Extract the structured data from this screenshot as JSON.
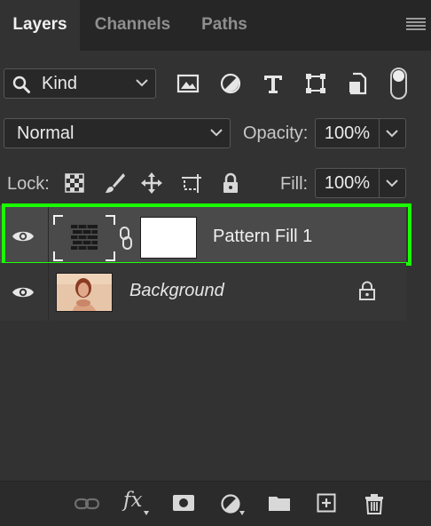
{
  "tabs": [
    {
      "label": "Layers",
      "active": true
    },
    {
      "label": "Channels",
      "active": false
    },
    {
      "label": "Paths",
      "active": false
    }
  ],
  "filter": {
    "kind_label": "Kind",
    "icons": [
      "image-filter-icon",
      "adjustment-filter-icon",
      "type-filter-icon",
      "shape-filter-icon",
      "smart-object-filter-icon"
    ],
    "filter_toggle_on": true
  },
  "blend": {
    "mode": "Normal",
    "opacity_label": "Opacity:",
    "opacity_value": "100%"
  },
  "lock": {
    "label": "Lock:",
    "icons": [
      "lock-transparent-pixels-icon",
      "lock-image-pixels-icon",
      "lock-position-icon",
      "prevent-auto-nesting-icon",
      "lock-all-icon"
    ],
    "fill_label": "Fill:",
    "fill_value": "100%"
  },
  "layers": [
    {
      "name": "Pattern Fill 1",
      "visible": true,
      "selected": true,
      "has_mask": true,
      "type": "pattern-fill"
    },
    {
      "name": "Background",
      "visible": true,
      "selected": false,
      "locked": true,
      "type": "image"
    }
  ],
  "bottom_toolbar": {
    "fx_label": "fx",
    "icons": [
      "link-layers-icon",
      "layer-style-icon",
      "add-mask-icon",
      "new-adjustment-layer-icon",
      "new-group-icon",
      "new-layer-icon",
      "delete-layer-icon"
    ]
  },
  "colors": {
    "panel_bg": "#323232",
    "tab_bar_bg": "#262626",
    "selected_layer_bg": "#4a4a4a",
    "highlight_outline": "#1aff00"
  }
}
